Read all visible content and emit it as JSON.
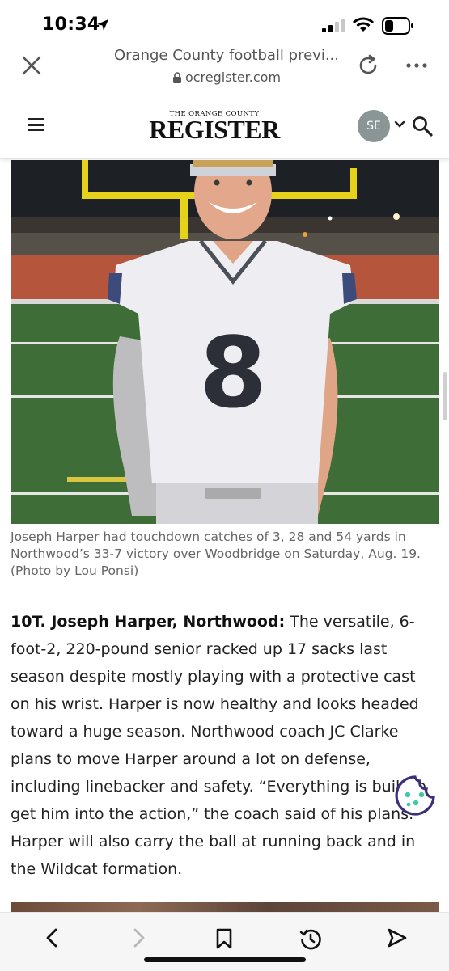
{
  "status_bar": {
    "time": "10:34",
    "icons": [
      "location-arrow-icon",
      "cellular-signal-icon",
      "wifi-icon",
      "battery-icon"
    ]
  },
  "browser": {
    "page_title": "Orange County football previ...",
    "domain": "ocregister.com",
    "icons": [
      "close-icon",
      "lock-icon",
      "reload-icon",
      "more-icon"
    ]
  },
  "site_header": {
    "logo_top": "THE ORANGE COUNTY",
    "logo_main": "REGISTER",
    "avatar_initials": "SE",
    "icons": [
      "menu-icon",
      "chevron-down-icon",
      "search-icon"
    ]
  },
  "photo": {
    "jersey_number": "8"
  },
  "caption": "Joseph Harper had touchdown catches of 3, 28 and 54 yards in Northwood’s 33-7 victory over Woodbridge on Saturday, Aug. 19. (Photo by Lou Ponsi)",
  "article": {
    "lead": "10T. Joseph Harper, Northwood:",
    "body": " The versatile, 6-foot-2, 220-pound senior racked up 17 sacks last season despite mostly playing with a protective cast on his wrist. Harper is now healthy and looks headed toward a huge season. Northwood coach JC Clarke plans to move Harper around a lot on defense, including linebacker and safety. “Everything is built to get him into the action,” the coach said of his plans. Harper will also carry the ball at running back and in the Wildcat formation."
  },
  "bottom_bar": {
    "icons": [
      "back-icon",
      "forward-icon",
      "bookmark-icon",
      "history-icon",
      "share-icon"
    ]
  },
  "colors": {
    "avatar_bg": "#8a9595",
    "cookie_accent": "#3b2f7a",
    "cookie_dots": "#3ec9a7",
    "goalpost_yellow": "#e6d21a",
    "turf_green": "#3e6d37"
  }
}
